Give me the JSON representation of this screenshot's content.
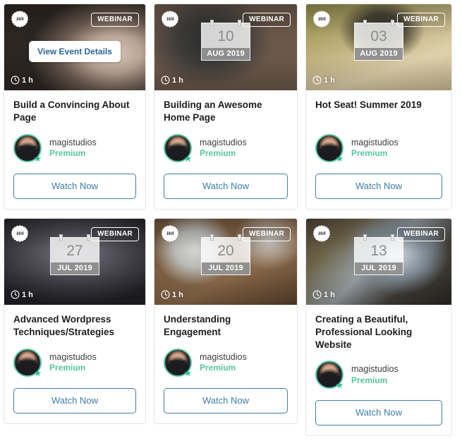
{
  "labels": {
    "view_event_details": "View Event Details",
    "watch_now": "Watch Now",
    "seal_text": "WA"
  },
  "colors": {
    "accent_teal": "#56c4a3",
    "link_blue": "#3b7ea6",
    "card_border": "#e4e4e4",
    "title_text": "#1d1d1d"
  },
  "cards": [
    {
      "type_badge": "WEBINAR",
      "duration": "1 h",
      "title": "Build a Convincing About Page",
      "author": "magistudios",
      "tier": "Premium",
      "watch_label": "Watch Now",
      "overlay_label": "View Event Details",
      "has_date": false,
      "day": "",
      "month_year": "",
      "hovered": true
    },
    {
      "type_badge": "WEBINAR",
      "duration": "1 h",
      "title": "Building an Awesome Home Page",
      "author": "magistudios",
      "tier": "Premium",
      "watch_label": "Watch Now",
      "overlay_label": "View Event Details",
      "has_date": true,
      "day": "10",
      "month_year": "AUG 2019",
      "hovered": false
    },
    {
      "type_badge": "WEBINAR",
      "duration": "1 h",
      "title": "Hot Seat! Summer 2019",
      "author": "magistudios",
      "tier": "Premium",
      "watch_label": "Watch Now",
      "overlay_label": "View Event Details",
      "has_date": true,
      "day": "03",
      "month_year": "AUG 2019",
      "hovered": false
    },
    {
      "type_badge": "WEBINAR",
      "duration": "1 h",
      "title": "Advanced Wordpress Techniques/Strategies",
      "author": "magistudios",
      "tier": "Premium",
      "watch_label": "Watch Now",
      "overlay_label": "View Event Details",
      "has_date": true,
      "day": "27",
      "month_year": "JUL 2019",
      "hovered": false
    },
    {
      "type_badge": "WEBINAR",
      "duration": "1 h",
      "title": "Understanding Engagement",
      "author": "magistudios",
      "tier": "Premium",
      "watch_label": "Watch Now",
      "overlay_label": "View Event Details",
      "has_date": true,
      "day": "20",
      "month_year": "JUL 2019",
      "hovered": false
    },
    {
      "type_badge": "WEBINAR",
      "duration": "1 h",
      "title": "Creating a Beautiful, Professional Looking Website",
      "author": "magistudios",
      "tier": "Premium",
      "watch_label": "Watch Now",
      "overlay_label": "View Event Details",
      "has_date": true,
      "day": "13",
      "month_year": "JUL 2019",
      "hovered": false
    }
  ]
}
